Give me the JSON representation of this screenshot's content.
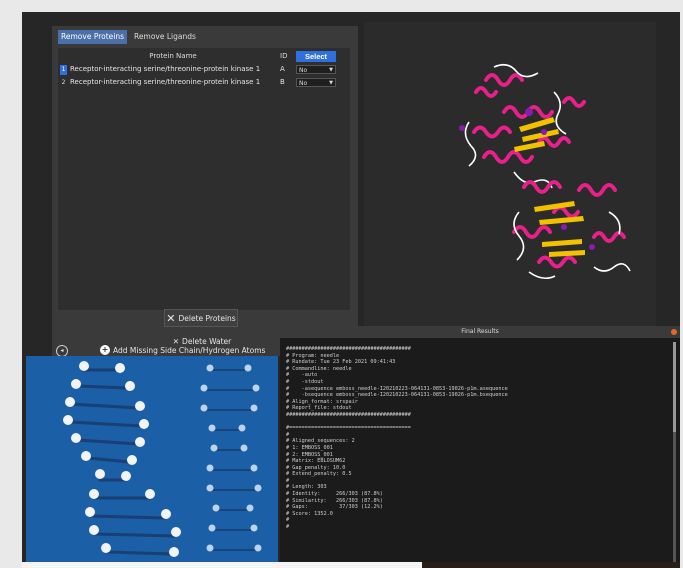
{
  "tabs": [
    {
      "label": "Remove Proteins",
      "active": true
    },
    {
      "label": "Remove Ligands",
      "active": false
    }
  ],
  "table": {
    "columns": {
      "name": "Protein Name",
      "id": "ID",
      "select": "Select"
    },
    "rows": [
      {
        "num": "1",
        "name": "Receptor-interacting serine/threonine-protein kinase 1",
        "id": "A",
        "value": "No"
      },
      {
        "num": "2",
        "name": "Receptor-interacting serine/threonine-protein kinase 1",
        "id": "B",
        "value": "No"
      }
    ]
  },
  "buttons": {
    "delete_proteins": "Delete Proteins",
    "delete_water": "Delete Water",
    "add_missing": "Add Missing Side Chain/Hydrogen Atoms"
  },
  "results": {
    "title": "Final Results",
    "lines": [
      "########################################",
      "# Program: needle",
      "# Rundate: Tue 23 Feb 2021 09:41:43",
      "# Commandline: needle",
      "#    -auto",
      "#    -stdout",
      "#    -asequence emboss_needle-I20210223-064131-0853-19026-p1m.asequence",
      "#    -bsequence emboss_needle-I20210223-064131-0853-19026-p1m.bsequence",
      "# Align_format: srspair",
      "# Report_file: stdout",
      "########################################",
      "",
      "#=======================================",
      "#",
      "# Aligned_sequences: 2",
      "# 1: EMBOSS_001",
      "# 2: EMBOSS_001",
      "# Matrix: EBLOSUM62",
      "# Gap_penalty: 10.0",
      "# Extend_penalty: 0.5",
      "#",
      "# Length: 303",
      "# Identity:     266/303 (87.8%)",
      "# Similarity:   266/303 (87.8%)",
      "# Gaps:          37/303 (12.2%)",
      "# Score: 1352.0",
      "#",
      "#"
    ]
  },
  "colors": {
    "accent": "#2f6fe0",
    "helix": "#e8208a",
    "sheet": "#f2c200",
    "coil": "#ffffff",
    "ligand": "#8a1ab0",
    "dna_bg": "#1b5fa6"
  }
}
